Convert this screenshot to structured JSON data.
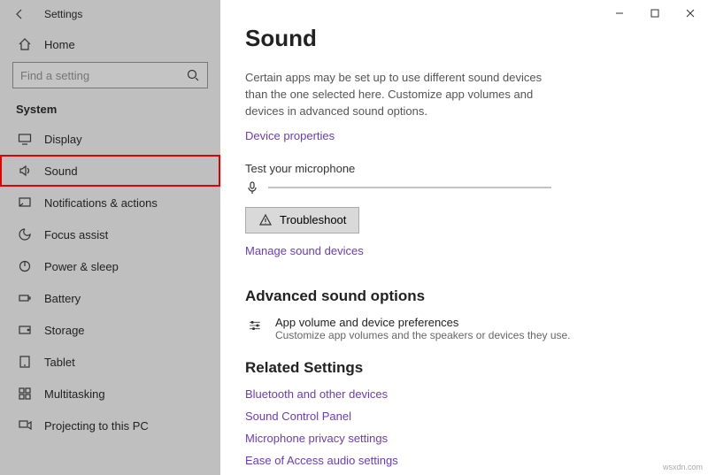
{
  "app": {
    "title": "Settings"
  },
  "sidebar": {
    "home": "Home",
    "search_placeholder": "Find a setting",
    "section": "System",
    "items": [
      {
        "label": "Display"
      },
      {
        "label": "Sound"
      },
      {
        "label": "Notifications & actions"
      },
      {
        "label": "Focus assist"
      },
      {
        "label": "Power & sleep"
      },
      {
        "label": "Battery"
      },
      {
        "label": "Storage"
      },
      {
        "label": "Tablet"
      },
      {
        "label": "Multitasking"
      },
      {
        "label": "Projecting to this PC"
      }
    ]
  },
  "main": {
    "title": "Sound",
    "description": "Certain apps may be set up to use different sound devices than the one selected here. Customize app volumes and devices in advanced sound options.",
    "device_properties_link": "Device properties",
    "test_label": "Test your microphone",
    "troubleshoot_label": "Troubleshoot",
    "manage_link": "Manage sound devices",
    "advanced_heading": "Advanced sound options",
    "pref_title": "App volume and device preferences",
    "pref_sub": "Customize app volumes and the speakers or devices they use.",
    "related_heading": "Related Settings",
    "related_links": [
      "Bluetooth and other devices",
      "Sound Control Panel",
      "Microphone privacy settings",
      "Ease of Access audio settings"
    ]
  },
  "watermark": "wsxdn.com"
}
